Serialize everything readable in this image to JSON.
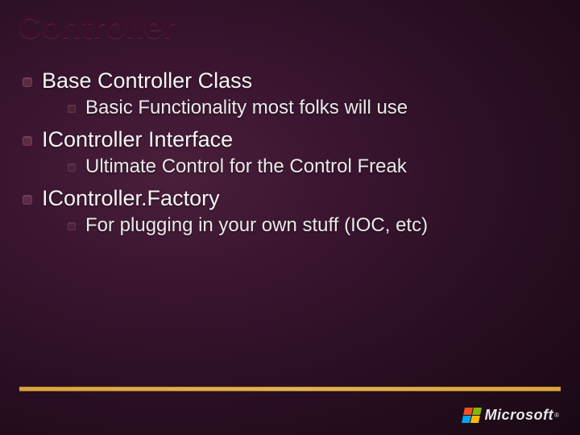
{
  "title": "Controller",
  "items": [
    {
      "label": "Base Controller Class",
      "sub": [
        {
          "label": "Basic Functionality most folks will use"
        }
      ]
    },
    {
      "label": "IController Interface",
      "sub": [
        {
          "label": "Ultimate Control for the Control Freak"
        }
      ]
    },
    {
      "label": "IController.Factory",
      "sub": [
        {
          "label": "For plugging in your own stuff (IOC, etc)"
        }
      ]
    }
  ],
  "logo": {
    "text": "Microsoft",
    "registered": "®"
  }
}
